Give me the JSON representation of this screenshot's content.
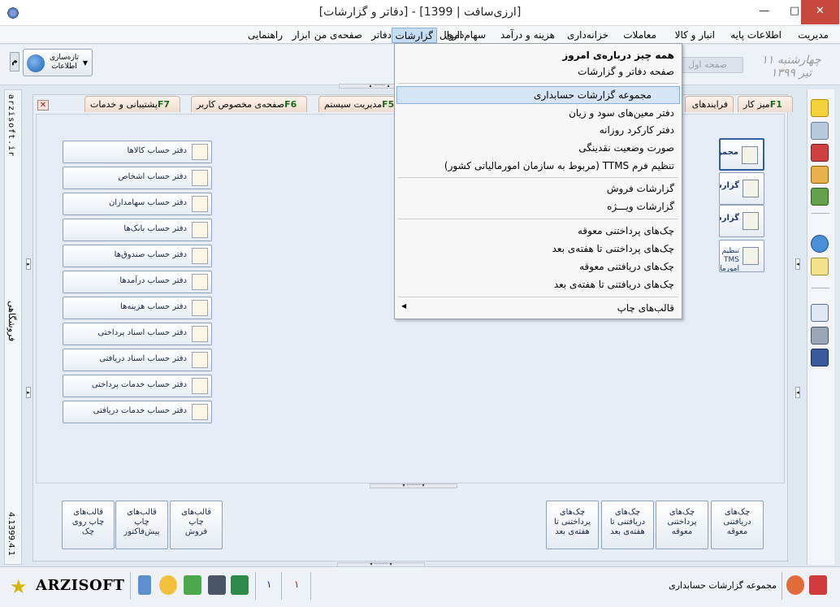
{
  "window": {
    "title": "[ارزی‌سافت | 1399] - [دفاتر و گزارشات]",
    "minimize": "—",
    "maximize": "□",
    "close": "✕"
  },
  "menubar": [
    "مدیریت",
    "اطلاعات پایه",
    "انبار و کالا",
    "معاملات",
    "خزانه‌داری",
    "هزینه و درآمد",
    "سهام‌داری",
    "اموال",
    "گزارشات",
    "دفاتر",
    "صفحه‌ی من",
    "ابزار",
    "راهنمایی"
  ],
  "menubar_active": "گزارشات",
  "toolbar": {
    "sync_label": "تازه‌سازی اطلاعات",
    "m_label": "م",
    "page_pill": "صفحه اول",
    "date_sign": "چهارشنبه ۱۱ تیر ۱۳۹۹"
  },
  "leftstrip": {
    "site": "arzisoft.ir",
    "store": "فروشگاهی",
    "version": "4.1399.4.1"
  },
  "tabs": [
    {
      "label": "میز کار",
      "key": "F1"
    },
    {
      "label": "فرایندهای",
      "key": ""
    },
    {
      "label": "مدیریت سیستم",
      "key": "F5"
    },
    {
      "label": "صفحه‌ی مخصوص کاربر",
      "key": "F6"
    },
    {
      "label": "پشتیبانی و خدمات",
      "key": "F7"
    }
  ],
  "tab_close": "✕",
  "ledgers": [
    "دفتر حساب کالاها",
    "دفتر حساب اشخاص",
    "دفتر حساب سهامداران",
    "دفتر حساب بانک‌ها",
    "دفتر حساب صندوق‌ها",
    "دفتر حساب درآمدها",
    "دفتر حساب هزینه‌ها",
    "دفتر حساب اسناد پرداختی",
    "دفتر حساب اسناد دریافتی",
    "دفتر حساب خدمات پرداختی",
    "دفتر حساب خدمات دریافتی"
  ],
  "big_buttons": [
    {
      "label": "مجموعه گزا"
    },
    {
      "label": "گزارشات فر"
    },
    {
      "label": "گزارشات وی"
    },
    {
      "label": "تنظیم فرم TMS امورمالیاتی کش"
    }
  ],
  "bottom_right_buttons": [
    "چک‌های\nدریافتنی\nمعوقه",
    "چک‌های\nپرداختنی\nمعوقه",
    "چک‌های\nدریافتنی تا\nهفته‌ی بعد",
    "چک‌های\nپرداختنی تا\nهفته‌ی بعد"
  ],
  "bottom_left_buttons": [
    "قالب‌های\nچاپ\nفروش",
    "قالب‌های\nچاپ\nپیش‌فاکتور",
    "قالب‌های\nچاپ روی\nچک"
  ],
  "statusbar": {
    "brand": "ARZISOFT",
    "num1": "۱",
    "num2": "۱",
    "text": "مجموعه گزارشات حسابداری"
  },
  "dropdown": {
    "items": [
      {
        "label": "همه چیز درباره‌ی امروز",
        "bold": true
      },
      {
        "label": "صفحه دفاتر و گزارشات"
      },
      {
        "label": "مجموعه گزارشات حسابداری",
        "highlighted": true
      },
      {
        "label": "دفتر معین‌های سود و زیان"
      },
      {
        "label": "دفتر کارکرد روزانه"
      },
      {
        "label": "صورت وضعیت نقدینگی"
      },
      {
        "label": "تنظیم فرم TTMS (مربوط به سازمان امورمالیاتی کشور)"
      },
      {
        "label": "گزارشات فروش"
      },
      {
        "label": "گزارشات ویـــژه"
      },
      {
        "label": "چک‌های پرداختنی معوقه"
      },
      {
        "label": "چک‌های پرداختنی تا هفته‌ی بعد"
      },
      {
        "label": "چک‌های دریافتنی معوقه"
      },
      {
        "label": "چک‌های دریافتنی تا هفته‌ی بعد"
      },
      {
        "label": "قالب‌های چاپ"
      }
    ]
  }
}
